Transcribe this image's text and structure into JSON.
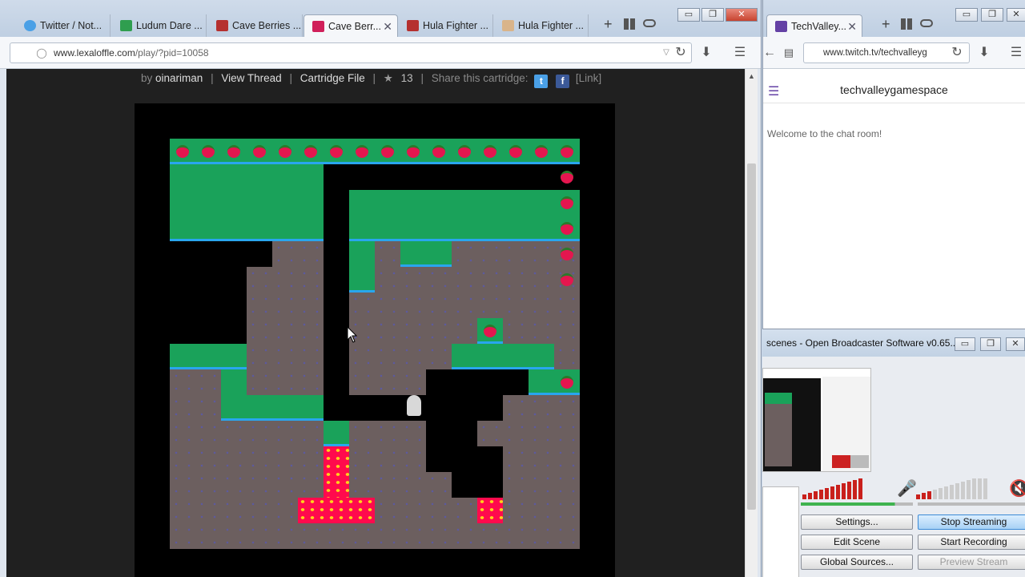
{
  "browser": {
    "tabs": [
      {
        "label": "Twitter / Not...",
        "icon": "twitter-icon",
        "color": "#4aa0e6"
      },
      {
        "label": "Ludum Dare ...",
        "icon": "sheets-icon",
        "color": "#2f9e4f"
      },
      {
        "label": "Cave Berries ...",
        "icon": "lexaloffle-icon",
        "color": "#b5302f"
      },
      {
        "label": "Cave Berr...",
        "icon": "lexaloffle-icon",
        "color": "#d01f5a",
        "active": true
      },
      {
        "label": "Hula Fighter ...",
        "icon": "lexaloffle-icon",
        "color": "#b5302f"
      },
      {
        "label": "Hula Fighter ...",
        "icon": "image-icon",
        "color": "#d9b48a"
      }
    ],
    "url_host": "www.lexaloffle.com",
    "url_path": "/play/?pid=10058",
    "window_buttons": [
      "▭",
      "❐",
      "✕"
    ]
  },
  "cartridge": {
    "by_label": "by",
    "author": "oinariman",
    "view_thread": "View Thread",
    "cartridge_file": "Cartridge File",
    "stars": "13",
    "share_label": "Share this cartridge:",
    "link_label": "[Link]"
  },
  "twitch": {
    "tab_label": "TechValley...",
    "url": "www.twitch.tv/techvalleyg",
    "channel": "techvalleygamespace",
    "welcome": "Welcome to the chat room!"
  },
  "obs": {
    "title": "scenes - Open Broadcaster Software v0.65...",
    "buttons": {
      "settings": "Settings...",
      "stop_streaming": "Stop Streaming",
      "edit_scene": "Edit Scene",
      "start_recording": "Start Recording",
      "global_sources": "Global Sources...",
      "preview_stream": "Preview Stream"
    }
  },
  "colors": {
    "grass": "#1aa25a",
    "edge": "#29a6ee",
    "dirt": "#6c5f5f",
    "lava": "#ff0a4d",
    "berry": "#e4164f"
  }
}
